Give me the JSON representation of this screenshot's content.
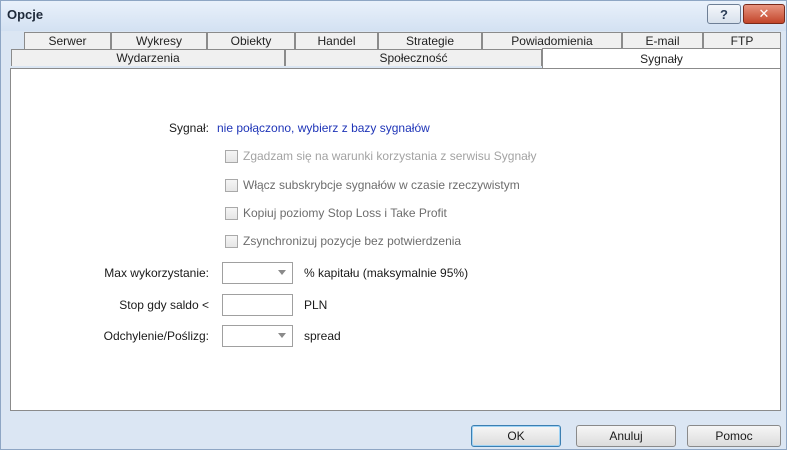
{
  "window": {
    "title": "Opcje",
    "help_symbol": "?",
    "close_symbol": "✕"
  },
  "tabs_row1": [
    "Serwer",
    "Wykresy",
    "Obiekty",
    "Handel",
    "Strategie",
    "Powiadomienia",
    "E-mail",
    "FTP"
  ],
  "tabs_row2": [
    "Wydarzenia",
    "Społeczność",
    "Sygnały"
  ],
  "active_tab": "Sygnały",
  "signal": {
    "label": "Sygnał:",
    "value": "nie połączono, wybierz z bazy sygnałów"
  },
  "checkboxes": [
    {
      "label": "Zgadzam się na warunki korzystania z serwisu Sygnały",
      "checked": false
    },
    {
      "label": "Włącz subskrybcje sygnałów w czasie rzeczywistym",
      "checked": false
    },
    {
      "label": "Kopiuj poziomy Stop Loss i Take Profit",
      "checked": false
    },
    {
      "label": "Zsynchronizuj pozycje bez potwierdzenia",
      "checked": false
    }
  ],
  "fields": {
    "max_usage": {
      "label": "Max wykorzystanie:",
      "value": "",
      "suffix": "% kapitału (maksymalnie 95%)"
    },
    "stop_balance": {
      "label": "Stop gdy saldo <",
      "value": "",
      "suffix": "PLN"
    },
    "deviation": {
      "label": "Odchylenie/Poślizg:",
      "value": "",
      "suffix": "spread"
    }
  },
  "buttons": {
    "ok": "OK",
    "cancel": "Anuluj",
    "help": "Pomoc"
  }
}
